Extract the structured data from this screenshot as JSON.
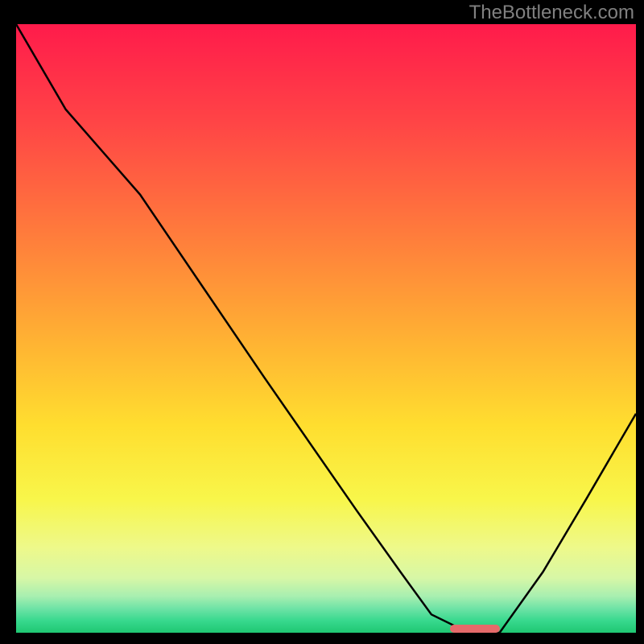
{
  "attribution": "TheBottleneck.com",
  "chart_data": {
    "type": "line",
    "title": "",
    "xlabel": "",
    "ylabel": "",
    "xlim": [
      0,
      100
    ],
    "ylim": [
      0,
      100
    ],
    "series": [
      {
        "name": "curve",
        "x": [
          0,
          8,
          20,
          24,
          40,
          55,
          62,
          67,
          73,
          78,
          85,
          92,
          100
        ],
        "y": [
          100,
          86,
          72,
          66,
          42,
          20,
          10,
          3,
          0,
          0,
          10,
          22,
          36
        ]
      }
    ],
    "optimal_marker": {
      "x_start": 70,
      "x_end": 78,
      "y": 0
    },
    "gradient_stops": [
      {
        "pct": 0,
        "color": "#ff1b4b"
      },
      {
        "pct": 16,
        "color": "#ff4446"
      },
      {
        "pct": 34,
        "color": "#ff7a3c"
      },
      {
        "pct": 52,
        "color": "#ffb233"
      },
      {
        "pct": 66,
        "color": "#ffde2f"
      },
      {
        "pct": 78,
        "color": "#f8f64a"
      },
      {
        "pct": 86,
        "color": "#eef98a"
      },
      {
        "pct": 91,
        "color": "#d7f7a6"
      },
      {
        "pct": 94,
        "color": "#a8efb0"
      },
      {
        "pct": 96,
        "color": "#6fe3a6"
      },
      {
        "pct": 98,
        "color": "#38d98e"
      },
      {
        "pct": 100,
        "color": "#1fc772"
      }
    ]
  }
}
